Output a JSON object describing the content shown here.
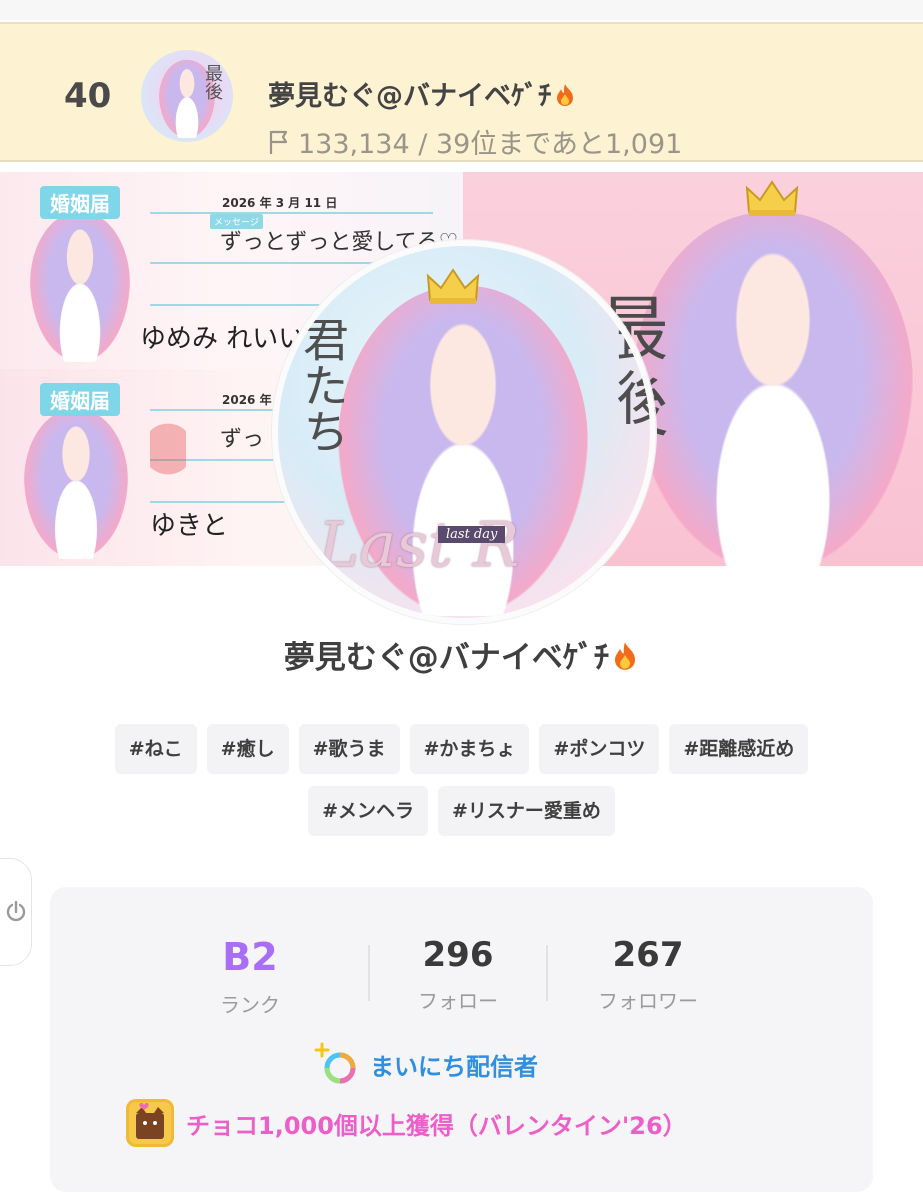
{
  "ranking": {
    "position": "40",
    "name": "夢見むぐ@バナイベｹﾞﾁ",
    "points": "133,134 / 39位まであと1,091"
  },
  "banner": {
    "doc_title": "婚姻届",
    "doc_year": "2026 年 3 月 11 日",
    "doc_msg_label": "メッセージ",
    "doc_msg_top": "ずっとずっと愛してる♡",
    "doc_msg_bottom": "ずっ",
    "doc_name_top": "ゆめみ れいい",
    "doc_name_bottom": "ゆきと",
    "right_kanji": "最後",
    "avatar_kanji_right": "最後",
    "avatar_kanji_left": "君たち",
    "avatar_script": "Last R",
    "avatar_badge": "last day"
  },
  "profile": {
    "name": "夢見むぐ@バナイベｹﾞﾁ",
    "tags": [
      "#ねこ",
      "#癒し",
      "#歌うま",
      "#かまちょ",
      "#ポンコツ",
      "#距離感近め",
      "#メンヘラ",
      "#リスナー愛重め"
    ]
  },
  "stats": {
    "rank_value": "B2",
    "rank_label": "ランク",
    "follow_value": "296",
    "follow_label": "フォロー",
    "follower_value": "267",
    "follower_label": "フォロワー"
  },
  "badges": {
    "daily": "まいにち配信者",
    "choco": "チョコ1,000個以上獲得（バレンタイン'26）"
  },
  "colors": {
    "rank_bar_bg": "#fdf2d2",
    "rank_text": "#a86ef5",
    "daily_text": "#2f8fe0",
    "choco_text": "#ec5fc9"
  }
}
